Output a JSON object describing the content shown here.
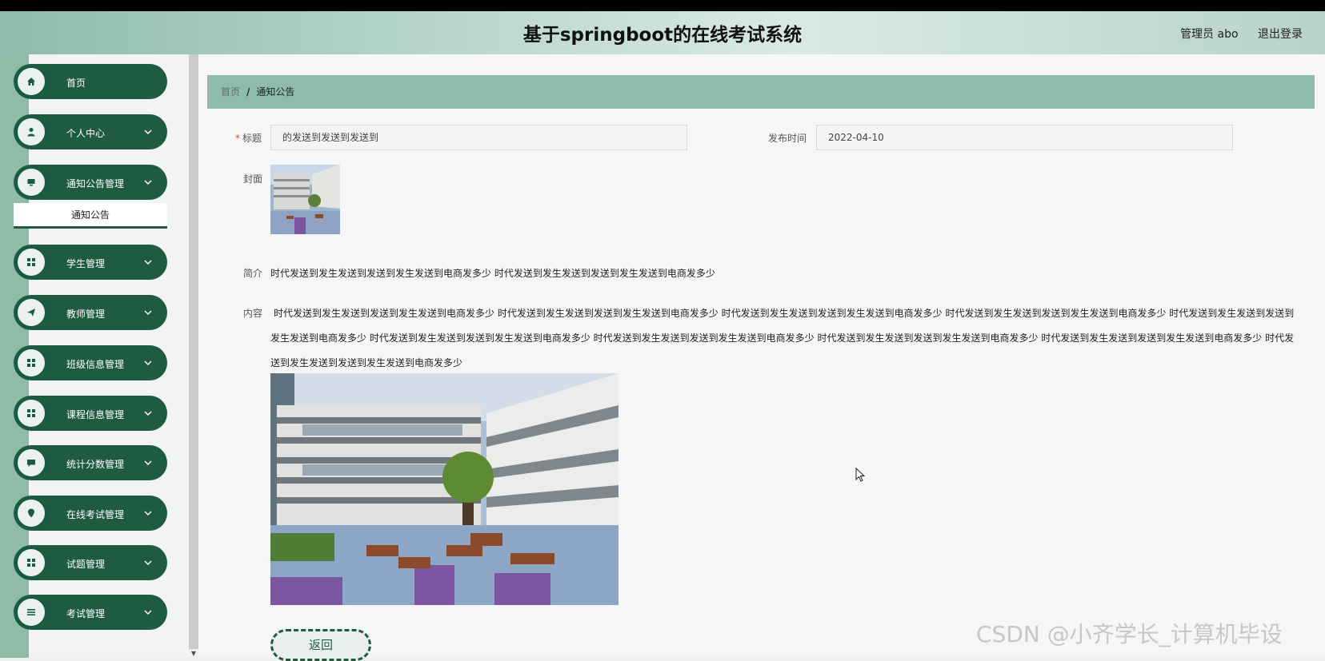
{
  "header": {
    "title": "基于springboot的在线考试系统",
    "user_label": "管理员 abo",
    "logout_label": "退出登录"
  },
  "sidebar": {
    "items": [
      {
        "label": "首页",
        "icon": "home-icon"
      },
      {
        "label": "个人中心",
        "icon": "person-icon"
      },
      {
        "label": "通知公告管理",
        "icon": "monitor-icon"
      },
      {
        "label": "学生管理",
        "icon": "grid-icon"
      },
      {
        "label": "教师管理",
        "icon": "send-icon"
      },
      {
        "label": "班级信息管理",
        "icon": "grid-icon"
      },
      {
        "label": "课程信息管理",
        "icon": "grid-icon"
      },
      {
        "label": "统计分数管理",
        "icon": "chat-icon"
      },
      {
        "label": "在线考试管理",
        "icon": "location-icon"
      },
      {
        "label": "试题管理",
        "icon": "grid-icon"
      },
      {
        "label": "考试管理",
        "icon": "list-icon"
      }
    ],
    "submenu_active": "通知公告"
  },
  "breadcrumb": {
    "home": "首页",
    "separator": "/",
    "current": "通知公告"
  },
  "form": {
    "title_label": "标题",
    "title_required_mark": "*",
    "title_value": "的发送到发送到发送到",
    "publish_time_label": "发布时间",
    "publish_time_value": "2022-04-10",
    "cover_label": "封面",
    "intro_label": "简介",
    "intro_value": "时代发送到发生发送到发送到发生发送到电商发多少 时代发送到发生发送到发送到发生发送到电商发多少",
    "content_label": "内容",
    "content_line1": "时代发送到发生发送到发送到发生发送到电商发多少 时代发送到发生发送到发送到发生发送到电商发多少 时代发送到发生发送到发送到发生发送到电商发多少 时代发送到发生发送到发送到发生发送到电商发多少 时代发送到发生发送到发送到",
    "content_line2": "发生发送到电商发多少 时代发送到发生发送到发送到发生发送到电商发多少 时代发送到发生发送到发送到发生发送到电商发多少 时代发送到发生发送到发送到发生发送到电商发多少 时代发送到发生发送到发送到发生发送到电商发多少 时代发",
    "content_line3": "送到发生发送到发送到发生发送到电商发多少",
    "back_label": "返回"
  },
  "watermark": "CSDN @小齐学长_计算机毕设"
}
